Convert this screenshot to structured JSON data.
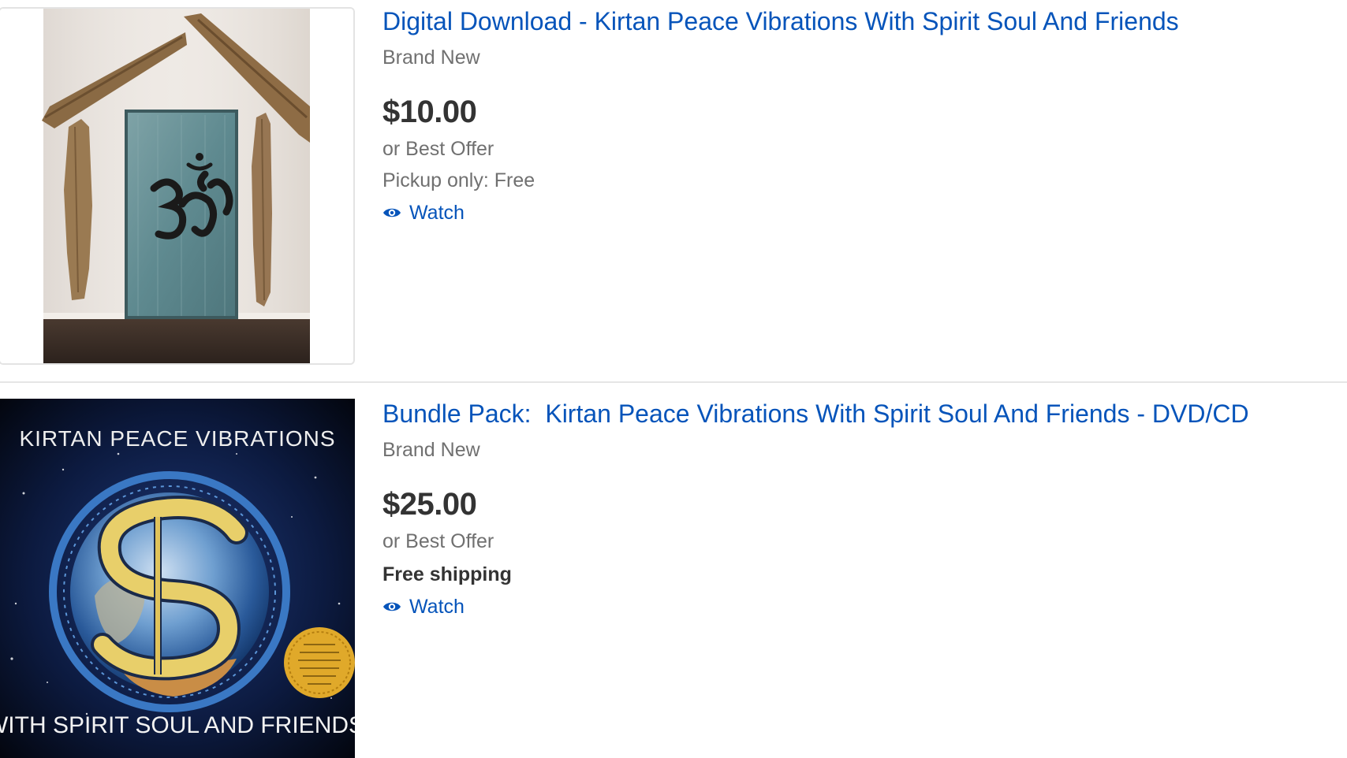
{
  "listings": [
    {
      "title": "Digital Download - Kirtan Peace Vibrations With Spirit Soul And Friends",
      "condition": "Brand New",
      "price": "$10.00",
      "offer": "or Best Offer",
      "shipping": "Pickup only: Free",
      "watch_label": "Watch",
      "image_icon": "om-door-photo"
    },
    {
      "title": "Bundle Pack:  Kirtan Peace Vibrations With Spirit Soul And Friends - DVD/CD",
      "condition": "Brand New",
      "price": "$25.00",
      "offer": "or Best Offer",
      "shipping": "Free shipping",
      "watch_label": "Watch",
      "image_icon": "album-cover",
      "cover_top_text": "KIRTAN PEACE VIBRATIONS",
      "cover_bottom_text": "WITH SPIRIT SOUL AND FRIENDS"
    }
  ],
  "colors": {
    "link": "#0654ba",
    "price": "#333333",
    "muted": "#707070",
    "divider": "#e5e5e5"
  }
}
